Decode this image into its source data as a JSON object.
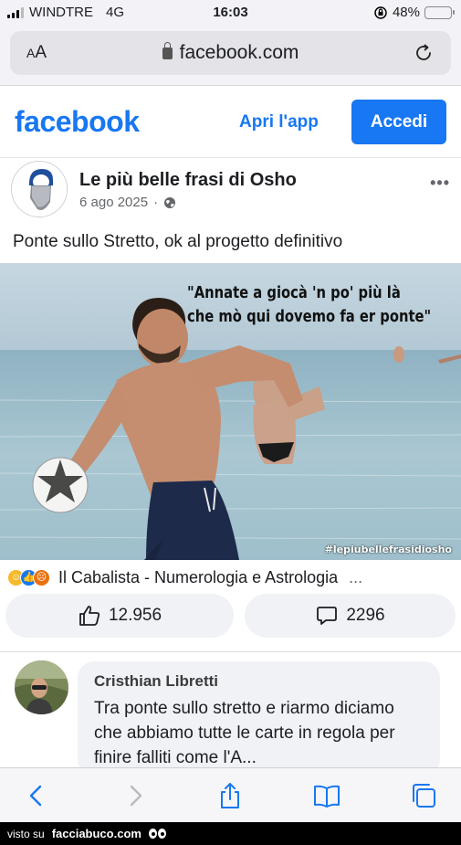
{
  "status_bar": {
    "carrier": "WINDTRE",
    "network": "4G",
    "time": "16:03",
    "battery": "48%",
    "battery_level": 0.48
  },
  "browser": {
    "aa_label_big": "A",
    "aa_label_small": "A",
    "url": "facebook.com"
  },
  "fb_header": {
    "logo": "facebook",
    "open_app": "Apri l'app",
    "login": "Accedi",
    "brand_color": "#1877f2"
  },
  "post": {
    "page_name": "Le più belle frasi di Osho",
    "date": "6 ago 2025",
    "separator": "·",
    "more": "•••",
    "text": "Ponte sullo Stretto, ok al progetto definitivo",
    "image_quote_line1": "\"Annate a giocà 'n po' più là",
    "image_quote_line2": "che mò qui dovemo fa er ponte\"",
    "image_hashtag": "#lepiubellefrasidiosho",
    "reacted_by": "Il Cabalista - Numerologia e Astrologia",
    "reactions_more": "...",
    "likes": "12.956",
    "comments": "2296"
  },
  "comment": {
    "author": "Cristhian Libretti",
    "text": "Tra ponte sullo stretto e riarmo diciamo che abbiamo tutte le carte in regola per finire falliti come l'A..."
  },
  "footer": {
    "prefix": "visto su",
    "site": "facciabuco.com"
  }
}
